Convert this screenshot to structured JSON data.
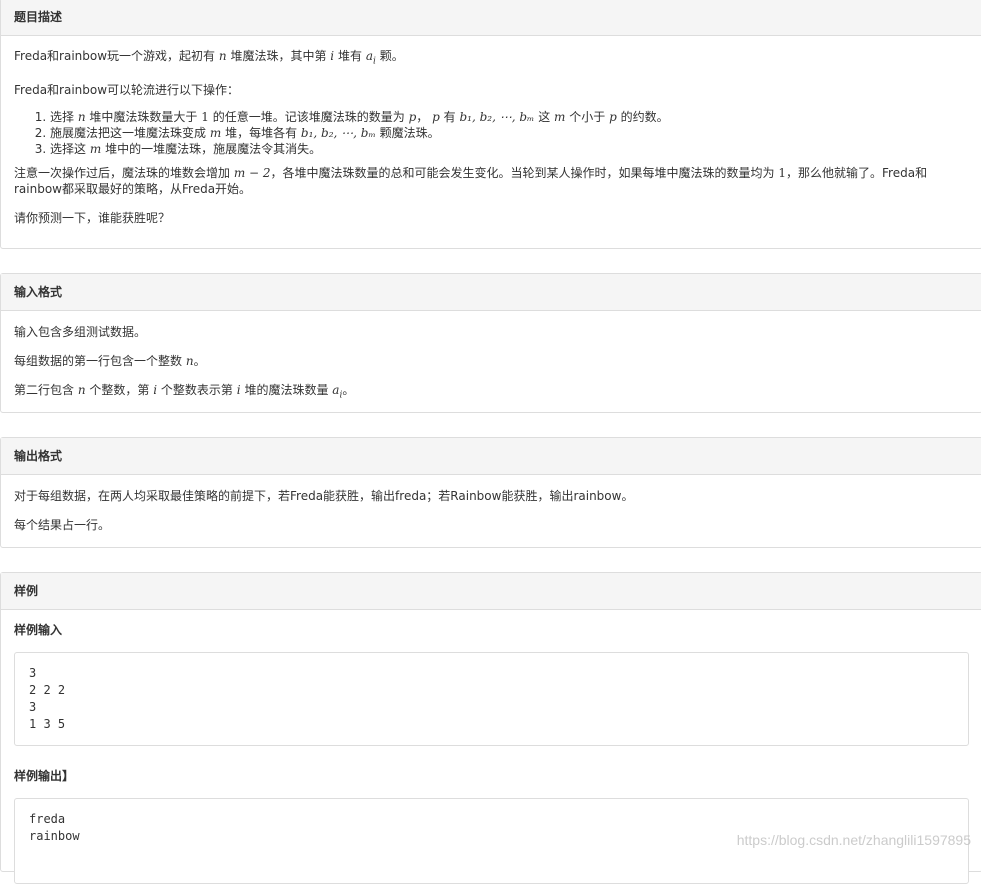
{
  "description": {
    "title": "题目描述",
    "p1_a": "Freda和rainbow玩一个游戏，起初有",
    "p1_n": "n",
    "p1_b": "堆魔法珠，其中第",
    "p1_i": "i",
    "p1_c": "堆有",
    "p1_a_sym": "a",
    "p1_a_sub": "i",
    "p1_d": "颗。",
    "p2": "Freda和rainbow可以轮流进行以下操作：",
    "step1_a": "选择",
    "step1_n": "n",
    "step1_b": "堆中魔法珠数量大于",
    "step1_one": "1",
    "step1_c": "的任意一堆。记该堆魔法珠的数量为",
    "step1_p": "p",
    "step1_d": "，",
    "step1_p2": "p",
    "step1_e": "有",
    "step1_list": "b₁, b₂, ⋯, bₘ",
    "step1_f": "这",
    "step1_m": "m",
    "step1_g": "个小于",
    "step1_p3": "p",
    "step1_h": "的约数。",
    "step2_a": "施展魔法把这一堆魔法珠变成",
    "step2_m": "m",
    "step2_b": "堆，每堆各有",
    "step2_list": "b₁, b₂, ⋯, bₘ",
    "step2_c": "颗魔法珠。",
    "step3_a": "选择这",
    "step3_m": "m",
    "step3_b": "堆中的一堆魔法珠，施展魔法令其消失。",
    "p3_a": "注意一次操作过后，魔法珠的堆数会增加",
    "p3_expr": "m − 2",
    "p3_b": "，各堆中魔法珠数量的总和可能会发生变化。当轮到某人操作时，如果每堆中魔法珠的数量均为",
    "p3_one": "1",
    "p3_c": "，那么他就输了。Freda和",
    "p3_d": "rainbow都采取最好的策略，从Freda开始。",
    "p4": "请你预测一下，谁能获胜呢？"
  },
  "input": {
    "title": "输入格式",
    "l1": "输入包含多组测试数据。",
    "l2_a": "每组数据的第一行包含一个整数",
    "l2_n": "n",
    "l2_b": "。",
    "l3_a": "第二行包含",
    "l3_n": "n",
    "l3_b": "个整数，第",
    "l3_i": "i",
    "l3_c": "个整数表示第",
    "l3_i2": "i",
    "l3_d": "堆的魔法珠数量",
    "l3_a_sym": "a",
    "l3_a_sub": "i",
    "l3_e": "。"
  },
  "output": {
    "title": "输出格式",
    "l1": "对于每组数据，在两人均采取最佳策略的前提下，若Freda能获胜，输出freda；若Rainbow能获胜，输出rainbow。",
    "l2": "每个结果占一行。"
  },
  "sample": {
    "title": "样例",
    "input_label": "样例输入",
    "input_text": "3\n2 2 2\n3\n1 3 5",
    "output_label": "样例输出】",
    "output_text": "freda\nrainbow"
  },
  "watermark": "https://blog.csdn.net/zhanglili1597895"
}
